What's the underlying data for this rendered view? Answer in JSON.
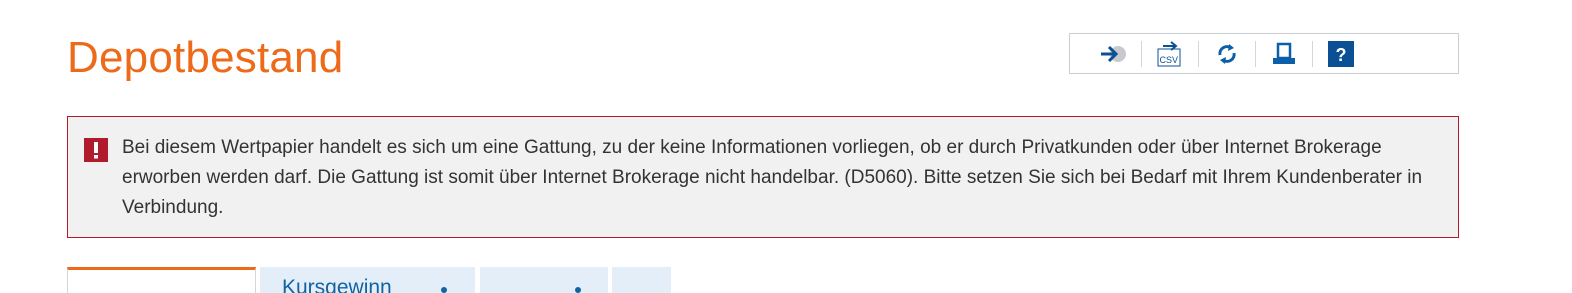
{
  "page": {
    "title": "Depotbestand"
  },
  "toolbar": {
    "buttons": [
      {
        "icon": "login-arrow-icon",
        "label": "Weiter"
      },
      {
        "icon": "csv-export-icon",
        "label": "CSV"
      },
      {
        "icon": "refresh-icon",
        "label": "Aktualisieren"
      },
      {
        "icon": "print-icon",
        "label": "Drucken"
      },
      {
        "icon": "help-icon",
        "label": "?"
      }
    ],
    "csv_label": "CSV",
    "help_label": "?",
    "accent_color": "#0b5ea8"
  },
  "alert": {
    "icon_label": "!",
    "message": "Bei diesem Wertpapier handelt es sich um eine Gattung, zu der keine Informationen vorliegen, ob er durch Privatkunden oder über Internet Brokerage erworben werden darf. Die Gattung ist somit über Internet Brokerage nicht handelbar. (D5060). Bitte setzen Sie sich bei Bedarf mit Ihrem Kundenberater in Verbindung.",
    "border_color": "#b01c2e",
    "background_color": "#f1f1f1"
  },
  "tabs": [
    {
      "label": "",
      "active": true
    },
    {
      "label": "Kursgewinn",
      "active": false
    },
    {
      "label": "",
      "active": false
    },
    {
      "label": "",
      "active": false
    }
  ],
  "colors": {
    "brand_orange": "#ec6a1a",
    "link_blue": "#1164a3",
    "tab_bg": "#e4eef8"
  }
}
